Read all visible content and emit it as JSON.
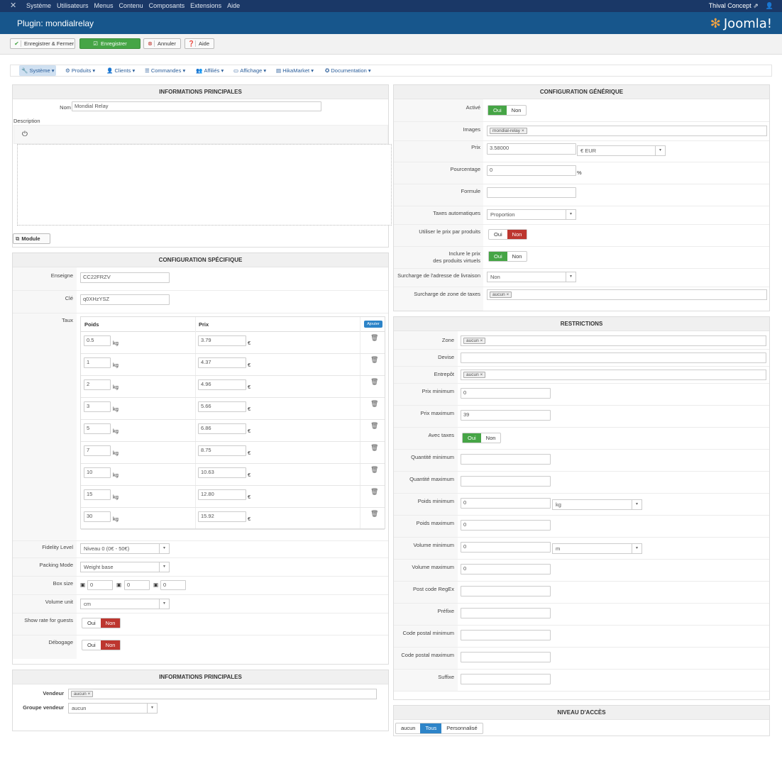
{
  "topbar": {
    "menu": [
      "Système",
      "Utilisateurs",
      "Menus",
      "Contenu",
      "Composants",
      "Extensions",
      "Aide"
    ],
    "user": "Thival Concept",
    "user_icon": "external-link-icon"
  },
  "header": {
    "title": "Plugin: mondialrelay",
    "brand": "Joomla!"
  },
  "toolbar": {
    "save_close": "Enregistrer & Fermer",
    "save": "Enregistrer",
    "cancel": "Annuler",
    "help": "Aide"
  },
  "nav": [
    "Système",
    "Produits",
    "Clients",
    "Commandes",
    "Affiliés",
    "Affichage",
    "HikaMarket",
    "Documentation"
  ],
  "main_info": {
    "header": "INFORMATIONS PRINCIPALES",
    "name_label": "Nom",
    "name_value": "Mondial Relay",
    "description_label": "Description",
    "module_button": "Module"
  },
  "specific": {
    "header": "CONFIGURATION SPÉCIFIQUE",
    "enseigne_label": "Enseigne",
    "enseigne_value": "CC22FRZV",
    "cle_label": "Clé",
    "cle_value": "q0XHzYSZ",
    "taux_label": "Taux",
    "col_poids": "Poids",
    "col_prix": "Prix",
    "add_button": "Ajouter",
    "unit_kg": "kg",
    "unit_eur": "€",
    "rates": [
      {
        "poids": "0.5",
        "prix": "3.79"
      },
      {
        "poids": "1",
        "prix": "4.37"
      },
      {
        "poids": "2",
        "prix": "4.96"
      },
      {
        "poids": "3",
        "prix": "5.66"
      },
      {
        "poids": "5",
        "prix": "6.86"
      },
      {
        "poids": "7",
        "prix": "8.75"
      },
      {
        "poids": "10",
        "prix": "10.63"
      },
      {
        "poids": "15",
        "prix": "12.80"
      },
      {
        "poids": "30",
        "prix": "15.92"
      }
    ],
    "fidelity_label": "Fidelity Level",
    "fidelity_value": "Niveau 0 (0€ - 50€)",
    "packing_label": "Packing Mode",
    "packing_value": "Weight base",
    "boxsize_label": "Box size",
    "box": [
      "0",
      "0",
      "0"
    ],
    "volume_label": "Volume unit",
    "volume_value": "cm",
    "guests_label": "Show rate for guests",
    "debug_label": "Débogage",
    "oui": "Oui",
    "non": "Non"
  },
  "vendor": {
    "header": "INFORMATIONS PRINCIPALES",
    "vendeur_label": "Vendeur",
    "vendeur_tag": "aucun",
    "groupe_label": "Groupe vendeur",
    "groupe_value": "aucun"
  },
  "generic": {
    "header": "CONFIGURATION GÉNÉRIQUE",
    "actif_label": "Activé",
    "images_label": "Images",
    "images_tag": "mondial-relay",
    "prix_label": "Prix",
    "prix_value": "3.58000",
    "currency": "€ EUR",
    "pourcentage_label": "Pourcentage",
    "pourcentage_value": "0",
    "percent_sign": "%",
    "formule_label": "Formule",
    "taxes_label": "Taxes automatiques",
    "taxes_value": "Proportion",
    "prix_produits_label": "Utiliser le prix par produits",
    "virtuels_label_1": "Inclure le prix",
    "virtuels_label_2": "des produits virtuels",
    "surcharge_adresse_label": "Surcharge de l'adresse de livraison",
    "surcharge_adresse_value": "Non",
    "surcharge_zone_label": "Surcharge de zone de taxes",
    "surcharge_zone_tag": "aucun",
    "oui": "Oui",
    "non": "Non"
  },
  "restrictions": {
    "header": "RESTRICTIONS",
    "zone_label": "Zone",
    "zone_tag": "aucun",
    "devise_label": "Devise",
    "entrepot_label": "Entrepôt",
    "entrepot_tag": "aucun",
    "prix_min_label": "Prix minimum",
    "prix_min_value": "0",
    "prix_max_label": "Prix maximum",
    "prix_max_value": "39",
    "avec_taxes_label": "Avec taxes",
    "qte_min_label": "Quantité minimum",
    "qte_max_label": "Quantité maximum",
    "poids_min_label": "Poids minimum",
    "poids_min_value": "0",
    "poids_unit": "kg",
    "poids_max_label": "Poids maximum",
    "poids_max_value": "0",
    "vol_min_label": "Volume minimum",
    "vol_min_value": "0",
    "vol_unit": "m",
    "vol_max_label": "Volume maximum",
    "vol_max_value": "0",
    "regex_label": "Post code RegEx",
    "prefixe_label": "Préfixe",
    "cp_min_label": "Code postal minimum",
    "cp_max_label": "Code postal maximum",
    "suffixe_label": "Suffixe",
    "oui": "Oui",
    "non": "Non"
  },
  "access": {
    "header": "NIVEAU D'ACCÈS",
    "options": [
      "aucun",
      "Tous",
      "Personnalisé"
    ]
  },
  "colors": {
    "green": "#46a546",
    "red": "#bd362f",
    "blue": "#2d84c8",
    "navy": "#1a3867"
  }
}
